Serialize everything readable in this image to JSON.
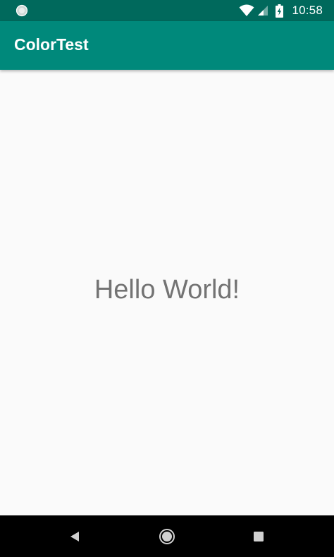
{
  "status_bar": {
    "time": "10:58",
    "left_icon": "system-circle-icon",
    "wifi_icon": "wifi-icon",
    "signal_icon": "cell-signal-icon",
    "battery_icon": "battery-charging-icon"
  },
  "app_bar": {
    "title": "ColorTest"
  },
  "content": {
    "text": "Hello World!"
  },
  "nav_bar": {
    "back_icon": "back-triangle-icon",
    "home_icon": "home-circle-icon",
    "recents_icon": "recents-square-icon"
  },
  "colors": {
    "status_bar": "#00695c",
    "app_bar": "#00897b",
    "background": "#fafafa",
    "text": "#737373",
    "nav_bar": "#000000"
  }
}
